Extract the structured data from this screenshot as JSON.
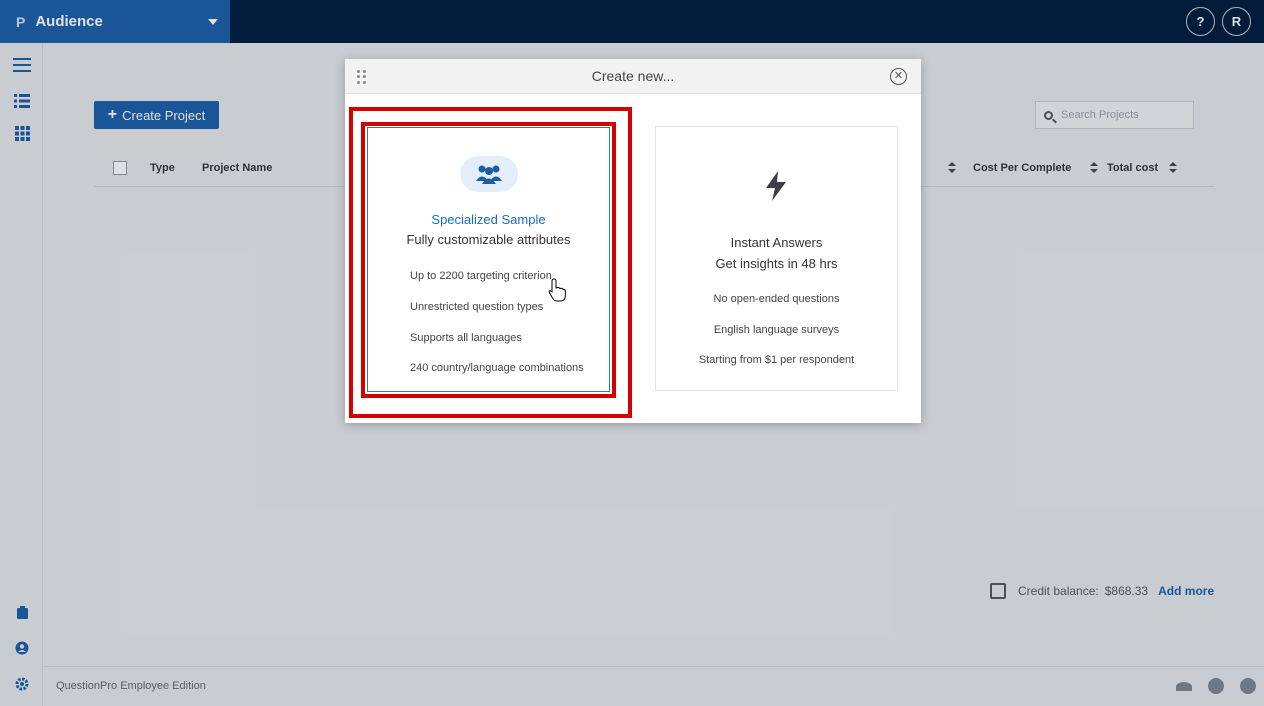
{
  "app": {
    "logo_glyph": "P",
    "module_name": "Audience",
    "help_label": "?",
    "user_initial": "R"
  },
  "sidebar": {
    "icons": [
      "menu-icon",
      "list-icon",
      "grid-icon",
      "trash-icon",
      "user-shield-icon",
      "gear-icon"
    ]
  },
  "main": {
    "create_button_label": "Create Project",
    "search_placeholder": "Search Projects",
    "table_headers": {
      "type": "Type",
      "project_name": "Project Name",
      "cost_per_complete": "Cost Per Complete",
      "total_cost": "Total cost"
    },
    "credit_label": "Credit balance:",
    "credit_value": "$868.33",
    "add_more_label": "Add more"
  },
  "footer": {
    "edition_text": "QuestionPro Employee Edition"
  },
  "modal": {
    "title": "Create new...",
    "cards": [
      {
        "title": "Specialized Sample",
        "subtitle": "Fully customizable attributes",
        "icon": "people-group-icon",
        "features": [
          "Up to 2200 targeting criterion",
          "Unrestricted question types",
          "Supports all languages",
          "240 country/language combinations"
        ],
        "selected": true
      },
      {
        "title": "Instant Answers",
        "subtitle": "Get insights in 48 hrs",
        "icon": "bolt-icon",
        "features": [
          "No open-ended questions",
          "English language surveys",
          "Starting from $1 per respondent"
        ],
        "selected": false
      }
    ]
  },
  "colors": {
    "topbar": "#001a3d",
    "brand": "#1a5da8",
    "highlight": "#d60000",
    "accent_link": "#1a5da8"
  }
}
